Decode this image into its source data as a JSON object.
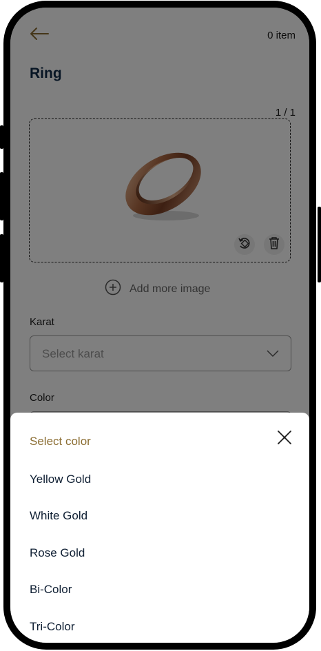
{
  "header": {
    "back_icon": "arrow-left-icon",
    "item_count": "0 item",
    "title": "Ring"
  },
  "image_section": {
    "counter": "1 / 1",
    "rotate_icon": "rotate-icon",
    "delete_icon": "trash-icon",
    "add_more_label": "Add more image",
    "add_icon": "plus-circle-icon"
  },
  "karat_field": {
    "label": "Karat",
    "placeholder": "Select karat"
  },
  "color_field": {
    "label": "Color"
  },
  "color_sheet": {
    "title": "Select color",
    "close_icon": "close-icon",
    "options": [
      "Yellow Gold",
      "White Gold",
      "Rose Gold",
      "Bi-Color",
      "Tri-Color"
    ]
  },
  "colors": {
    "title": "#0f2a48",
    "accent": "#8b6d32",
    "overlay": "rgba(0,0,0,0.5)"
  }
}
